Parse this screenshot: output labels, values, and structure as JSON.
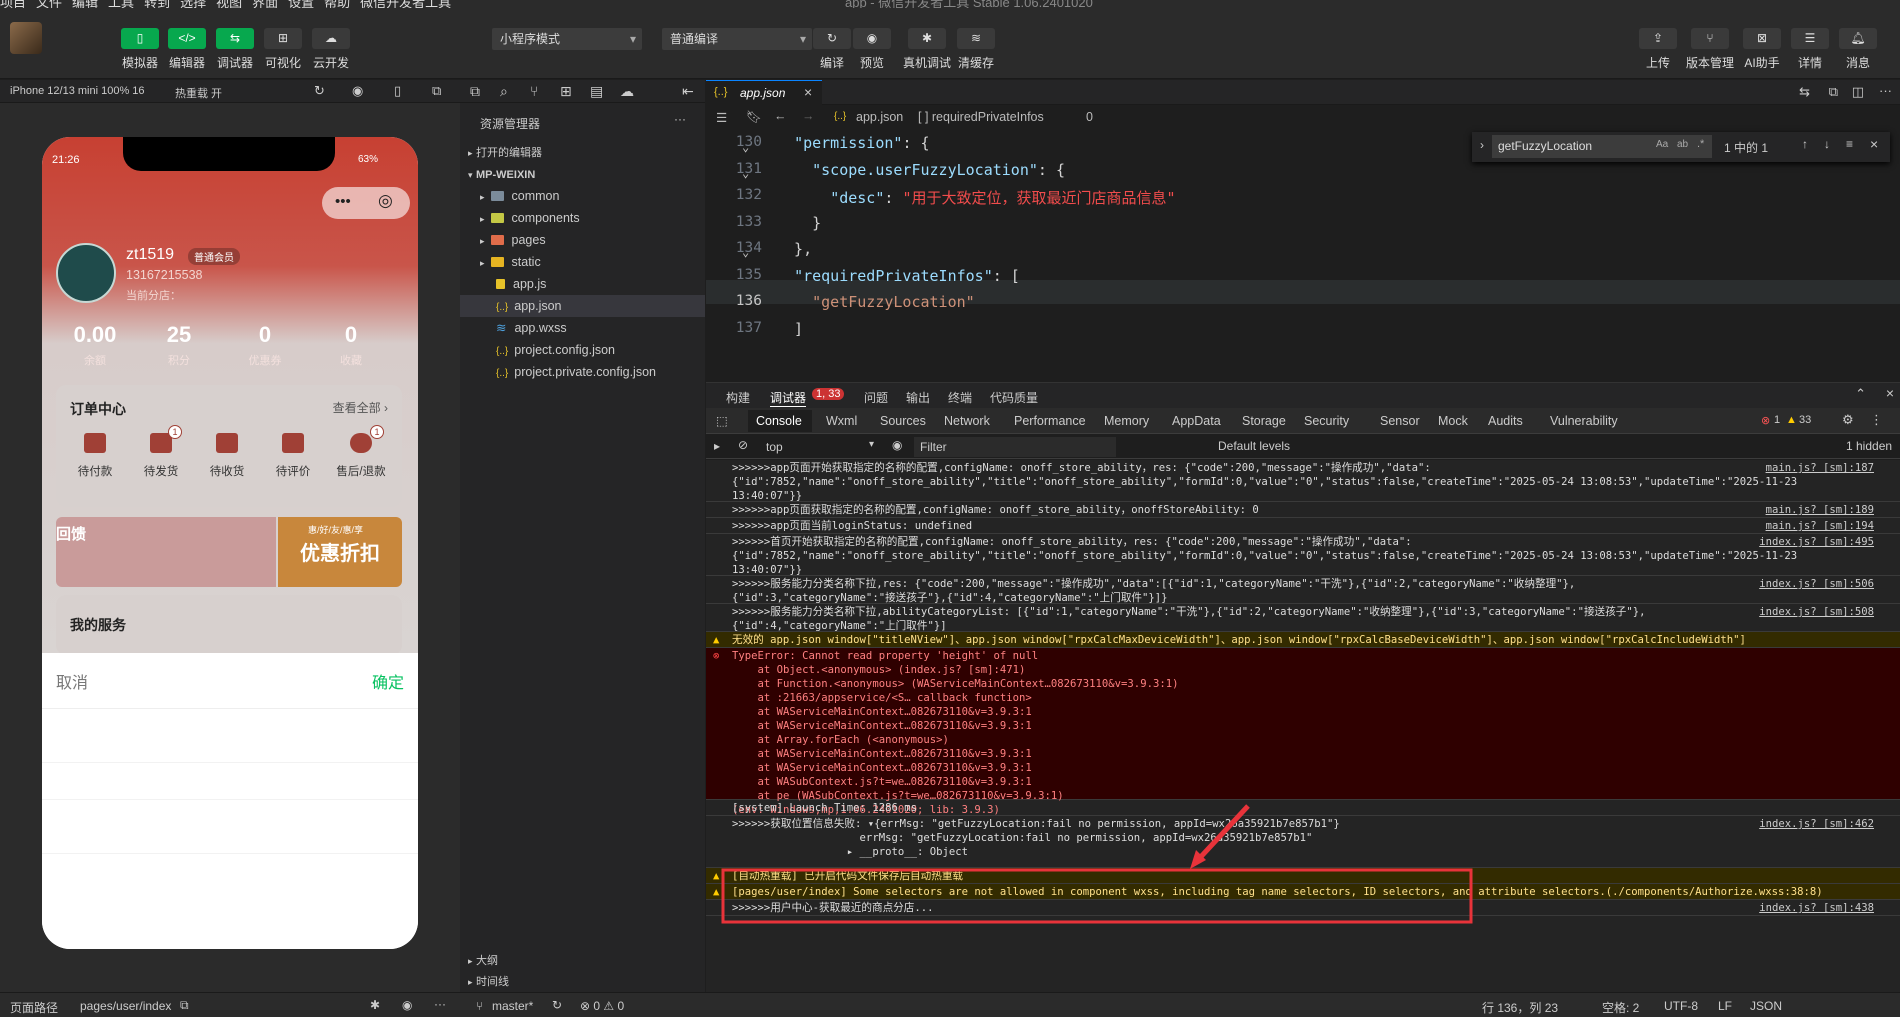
{
  "menubar": {
    "items": [
      "项目",
      "文件",
      "编辑",
      "工具",
      "转到",
      "选择",
      "视图",
      "界面",
      "设置",
      "帮助",
      "微信开发者工具"
    ],
    "title": "app - 微信开发者工具 Stable 1.06.2401020"
  },
  "toolbar": {
    "simulator": "模拟器",
    "editor": "编辑器",
    "debugger": "调试器",
    "visual": "可视化",
    "cloud": "云开发",
    "mode": "小程序模式",
    "compile_mode": "普通编译",
    "compile": "编译",
    "preview": "预览",
    "remote_debug": "真机调试",
    "clear_cache": "清缓存",
    "upload": "上传",
    "version": "版本管理",
    "ai": "AI助手",
    "details": "详情",
    "messages": "消息"
  },
  "simulator": {
    "device": "iPhone 12/13 mini 100% 16",
    "hot_reload": "热重载 开",
    "time": "21:26",
    "battery": "63%",
    "user": {
      "name": "zt1519",
      "badge": "普通会员",
      "phone": "13167215538",
      "store": "当前分店："
    },
    "stats": [
      {
        "value": "0.00",
        "label": "余额"
      },
      {
        "value": "25",
        "label": "积分"
      },
      {
        "value": "0",
        "label": "优惠券"
      },
      {
        "value": "0",
        "label": "收藏"
      }
    ],
    "orders": {
      "title": "订单中心",
      "view_all": "查看全部 ›",
      "items": [
        {
          "label": "待付款",
          "badge": ""
        },
        {
          "label": "待发货",
          "badge": "1"
        },
        {
          "label": "待收货",
          "badge": ""
        },
        {
          "label": "待评价",
          "badge": ""
        },
        {
          "label": "售后/退款",
          "badge": "1"
        }
      ]
    },
    "banner_left": "回馈",
    "banner_tag": "惠/好/友/惠/享",
    "banner_right": "优惠折扣",
    "service": "我的服务",
    "sheet": {
      "cancel": "取消",
      "confirm": "确定"
    }
  },
  "explorer": {
    "title": "资源管理器",
    "open_editors": "打开的编辑器",
    "root": "MP-WEIXIN",
    "items": [
      {
        "name": "common",
        "type": "folder",
        "color": "#7b8b9a"
      },
      {
        "name": "components",
        "type": "folder",
        "color": "#c4c845"
      },
      {
        "name": "pages",
        "type": "folder",
        "color": "#e06c4a"
      },
      {
        "name": "static",
        "type": "folder",
        "color": "#e6b422"
      },
      {
        "name": "app.js",
        "type": "js"
      },
      {
        "name": "app.json",
        "type": "json"
      },
      {
        "name": "app.wxss",
        "type": "wxss"
      },
      {
        "name": "project.config.json",
        "type": "json"
      },
      {
        "name": "project.private.config.json",
        "type": "json"
      }
    ],
    "outline": "大纲",
    "timeline": "时间线"
  },
  "editor": {
    "tab": "app.json",
    "breadcrumb": [
      "app.json",
      "[ ] requiredPrivateInfos",
      "0"
    ],
    "lines": [
      {
        "n": "130",
        "parts": [
          [
            "b",
            "  "
          ],
          [
            "k",
            "\"permission\""
          ],
          [
            "b",
            ": {"
          ]
        ]
      },
      {
        "n": "131",
        "parts": [
          [
            "b",
            "    "
          ],
          [
            "k",
            "\"scope.userFuzzyLocation\""
          ],
          [
            "b",
            ": {"
          ]
        ]
      },
      {
        "n": "132",
        "parts": [
          [
            "b",
            "      "
          ],
          [
            "k",
            "\"desc\""
          ],
          [
            "b",
            ": "
          ],
          [
            "s2",
            "\"用于大致定位，获取最近门店商品信息\""
          ]
        ]
      },
      {
        "n": "133",
        "parts": [
          [
            "b",
            "    }"
          ]
        ]
      },
      {
        "n": "134",
        "parts": [
          [
            "b",
            "  },"
          ]
        ]
      },
      {
        "n": "135",
        "parts": [
          [
            "b",
            "  "
          ],
          [
            "k",
            "\"requiredPrivateInfos\""
          ],
          [
            "b",
            ": ["
          ]
        ]
      },
      {
        "n": "136",
        "parts": [
          [
            "b",
            "    "
          ],
          [
            "s",
            "\"getFuzzyLocation\""
          ]
        ]
      },
      {
        "n": "137",
        "parts": [
          [
            "b",
            "  ]"
          ]
        ]
      }
    ],
    "find": {
      "query": "getFuzzyLocation",
      "result": "1 中的 1"
    }
  },
  "devtools": {
    "tabs": [
      "构建",
      "调试器",
      "问题",
      "输出",
      "终端",
      "代码质量"
    ],
    "errors_badge": "1, 33",
    "console_tabs": [
      "Console",
      "Wxml",
      "Sources",
      "Network",
      "Performance",
      "Memory",
      "AppData",
      "Storage",
      "Security",
      "Sensor",
      "Mock",
      "Audits",
      "Vulnerability"
    ],
    "err_count": "1",
    "warn_count": "33",
    "context": "top",
    "filter_placeholder": "Filter",
    "levels": "Default levels",
    "hidden": "1 hidden"
  },
  "console": {
    "rows": [
      {
        "kind": "log",
        "text": ">>>>>>app页面开始获取指定的名称的配置,configName: onoff_store_ability，res: {\"code\":200,\"message\":\"操作成功\",\"data\":\n{\"id\":7852,\"name\":\"onoff_store_ability\",\"title\":\"onoff_store_ability\",\"formId\":0,\"value\":\"0\",\"status\":false,\"createTime\":\"2025-05-24 13:08:53\",\"updateTime\":\"2025-11-23\n13:40:07\"}}",
        "src": "main.js? [sm]:187"
      },
      {
        "kind": "log",
        "text": ">>>>>>app页面获取指定的名称的配置,configName: onoff_store_ability，onoffStoreAbility: 0",
        "src": "main.js? [sm]:189"
      },
      {
        "kind": "log",
        "text": ">>>>>>app页面当前loginStatus: undefined",
        "src": "main.js? [sm]:194"
      },
      {
        "kind": "log",
        "text": ">>>>>>首页开始获取指定的名称的配置,configName: onoff_store_ability，res: {\"code\":200,\"message\":\"操作成功\",\"data\":\n{\"id\":7852,\"name\":\"onoff_store_ability\",\"title\":\"onoff_store_ability\",\"formId\":0,\"value\":\"0\",\"status\":false,\"createTime\":\"2025-05-24 13:08:53\",\"updateTime\":\"2025-11-23\n13:40:07\"}}",
        "src": "index.js? [sm]:495"
      },
      {
        "kind": "log",
        "text": ">>>>>>服务能力分类名称下拉,res: {\"code\":200,\"message\":\"操作成功\",\"data\":[{\"id\":1,\"categoryName\":\"干洗\"},{\"id\":2,\"categoryName\":\"收纳整理\"},\n{\"id\":3,\"categoryName\":\"接送孩子\"},{\"id\":4,\"categoryName\":\"上门取件\"}]}",
        "src": "index.js? [sm]:506"
      },
      {
        "kind": "log",
        "text": ">>>>>>服务能力分类名称下拉,abilityCategoryList: [{\"id\":1,\"categoryName\":\"干洗\"},{\"id\":2,\"categoryName\":\"收纳整理\"},{\"id\":3,\"categoryName\":\"接送孩子\"},\n{\"id\":4,\"categoryName\":\"上门取件\"}]",
        "src": "index.js? [sm]:508"
      },
      {
        "kind": "warn",
        "text": "无效的 app.json window[\"titleNView\"]、app.json window[\"rpxCalcMaxDeviceWidth\"]、app.json window[\"rpxCalcBaseDeviceWidth\"]、app.json window[\"rpxCalcIncludeWidth\"]",
        "src": ""
      },
      {
        "kind": "err",
        "text": "TypeError: Cannot read property 'height' of null\n    at Object.<anonymous> (index.js? [sm]:471)\n    at Function.<anonymous> (WAServiceMainContext…082673110&v=3.9.3:1)\n    at :21663/appservice/<S… callback function>\n    at WAServiceMainContext…082673110&v=3.9.3:1\n    at WAServiceMainContext…082673110&v=3.9.3:1\n    at Array.forEach (<anonymous>)\n    at WAServiceMainContext…082673110&v=3.9.3:1\n    at WAServiceMainContext…082673110&v=3.9.3:1\n    at WASubContext.js?t=we…082673110&v=3.9.3:1\n    at pe (WASubContext.js?t=we…082673110&v=3.9.3:1)\n(env: Windows,mp,1.06.2401020; lib: 3.9.3)",
        "src": ""
      },
      {
        "kind": "log",
        "text": "[system] Launch Time: 1286 ms",
        "src": ""
      },
      {
        "kind": "log",
        "text": ">>>>>>获取位置信息失败: ▾{errMsg: \"getFuzzyLocation:fail no permission, appId=wx26a35921b7e857b1\"}\n                    errMsg: \"getFuzzyLocation:fail no permission, appId=wx26a35921b7e857b1\"\n                  ▸ __proto__: Object",
        "src": "index.js? [sm]:462"
      },
      {
        "kind": "warn",
        "text": "[自动热重载] 已开启代码文件保存后自动热重载",
        "src": ""
      },
      {
        "kind": "warn",
        "text": "[pages/user/index] Some selectors are not allowed in component wxss, including tag name selectors, ID selectors, and attribute selectors.(./components/Authorize.wxss:38:8)",
        "src": ""
      },
      {
        "kind": "log",
        "text": ">>>>>>用户中心-获取最近的商点分店...",
        "src": "index.js? [sm]:438"
      }
    ]
  },
  "status": {
    "path_label": "页面路径",
    "page": "pages/user/index",
    "branch": "master*",
    "problems": "⊗ 0 ⚠ 0",
    "cursor": "行 136，列 23",
    "spaces": "空格: 2",
    "encoding": "UTF-8",
    "eol": "LF",
    "lang": "JSON"
  }
}
